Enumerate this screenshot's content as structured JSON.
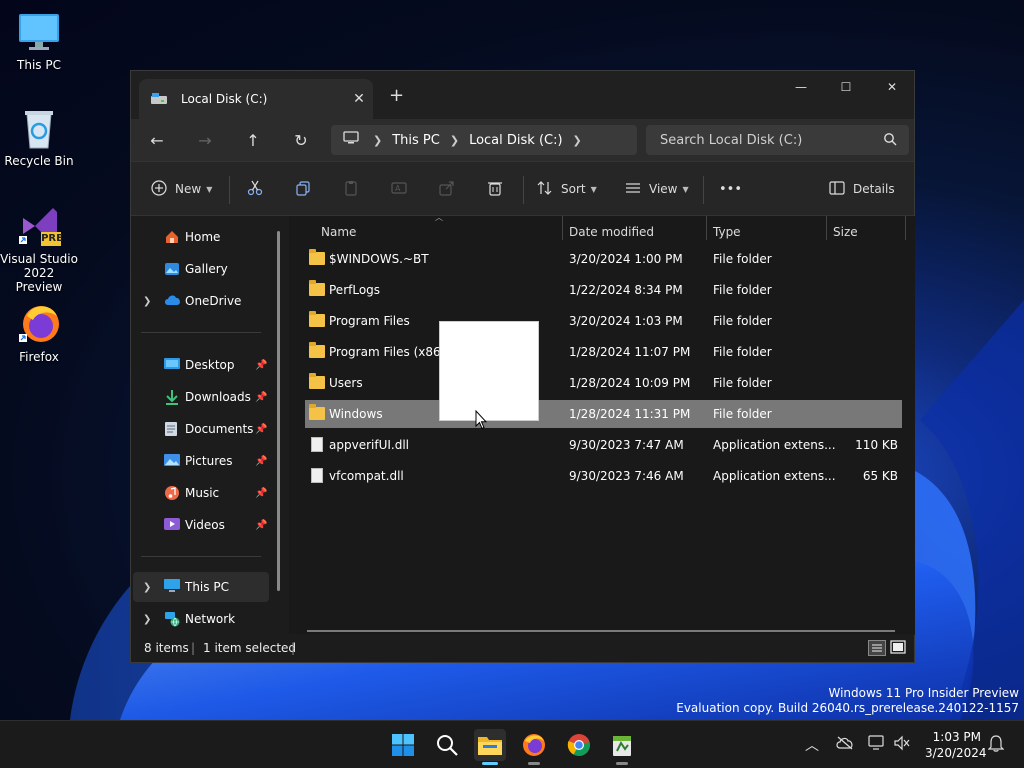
{
  "desktop": {
    "icons": [
      {
        "label": "This PC"
      },
      {
        "label": "Recycle Bin"
      },
      {
        "label": "Visual Studio 2022 Preview",
        "badge": "PRE"
      },
      {
        "label": "Firefox"
      }
    ]
  },
  "window": {
    "tab_title": "Local Disk (C:)",
    "tab_close": "✕",
    "new_tab": "+",
    "controls": {
      "minimize": "—",
      "maximize": "☐",
      "close": "✕"
    }
  },
  "nav": {
    "back": "←",
    "forward": "→",
    "up": "↑",
    "refresh": "↻",
    "breadcrumbs": [
      "This PC",
      "Local Disk (C:)"
    ],
    "search_placeholder": "Search Local Disk (C:)"
  },
  "toolbar": {
    "new_label": "New",
    "sort_label": "Sort",
    "view_label": "View",
    "more_label": "•••",
    "details_label": "Details"
  },
  "sidebar": {
    "items": [
      {
        "label": "Home"
      },
      {
        "label": "Gallery"
      },
      {
        "label": "OneDrive"
      },
      {
        "label": "Desktop"
      },
      {
        "label": "Downloads"
      },
      {
        "label": "Documents"
      },
      {
        "label": "Pictures"
      },
      {
        "label": "Music"
      },
      {
        "label": "Videos"
      },
      {
        "label": "This PC"
      },
      {
        "label": "Network"
      }
    ]
  },
  "columns": {
    "name": "Name",
    "date": "Date modified",
    "type": "Type",
    "size": "Size"
  },
  "files": [
    {
      "name": "$WINDOWS.~BT",
      "date": "3/20/2024 1:00 PM",
      "type": "File folder",
      "size": ""
    },
    {
      "name": "PerfLogs",
      "date": "1/22/2024 8:34 PM",
      "type": "File folder",
      "size": ""
    },
    {
      "name": "Program Files",
      "date": "3/20/2024 1:03 PM",
      "type": "File folder",
      "size": ""
    },
    {
      "name": "Program Files (x86)",
      "date": "1/28/2024 11:07 PM",
      "type": "File folder",
      "size": ""
    },
    {
      "name": "Users",
      "date": "1/28/2024 10:09 PM",
      "type": "File folder",
      "size": ""
    },
    {
      "name": "Windows",
      "date": "1/28/2024 11:31 PM",
      "type": "File folder",
      "size": ""
    },
    {
      "name": "appverifUI.dll",
      "date": "9/30/2023 7:47 AM",
      "type": "Application extens...",
      "size": "110 KB"
    },
    {
      "name": "vfcompat.dll",
      "date": "9/30/2023 7:46 AM",
      "type": "Application extens...",
      "size": "65 KB"
    }
  ],
  "status": {
    "count": "8 items",
    "selected": "1 item selected"
  },
  "watermark": {
    "line1": "Windows 11 Pro Insider Preview",
    "line2": "Evaluation copy. Build 26040.rs_prerelease.240122-1157"
  },
  "clock": {
    "time": "1:03 PM",
    "date": "3/20/2024"
  },
  "colors": {
    "accent": "#60cdff",
    "folder": "#f4c247",
    "selected_row": "#787878"
  }
}
